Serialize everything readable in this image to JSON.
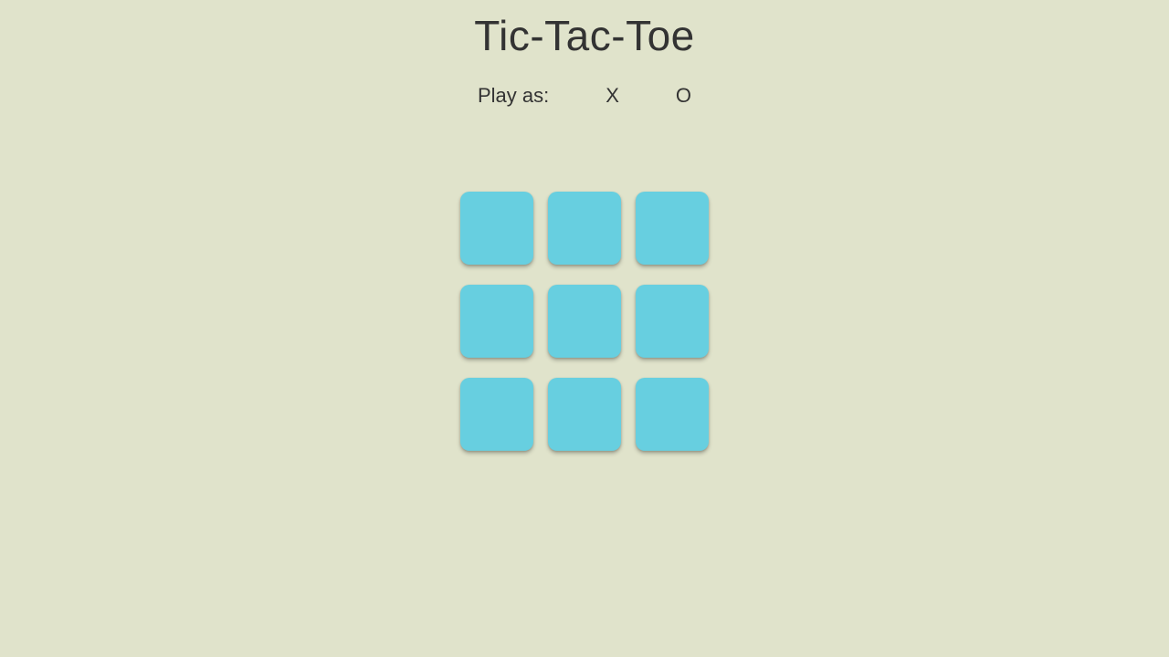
{
  "title": "Tic-Tac-Toe",
  "playAs": {
    "label": "Play as:",
    "options": [
      {
        "label": "X",
        "selected": false
      },
      {
        "label": "O",
        "selected": false
      }
    ]
  },
  "board": {
    "cells": [
      "",
      "",
      "",
      "",
      "",
      "",
      "",
      "",
      ""
    ]
  },
  "colors": {
    "background": "#e0e3cb",
    "cell": "#67cfe0",
    "text": "#333333"
  }
}
